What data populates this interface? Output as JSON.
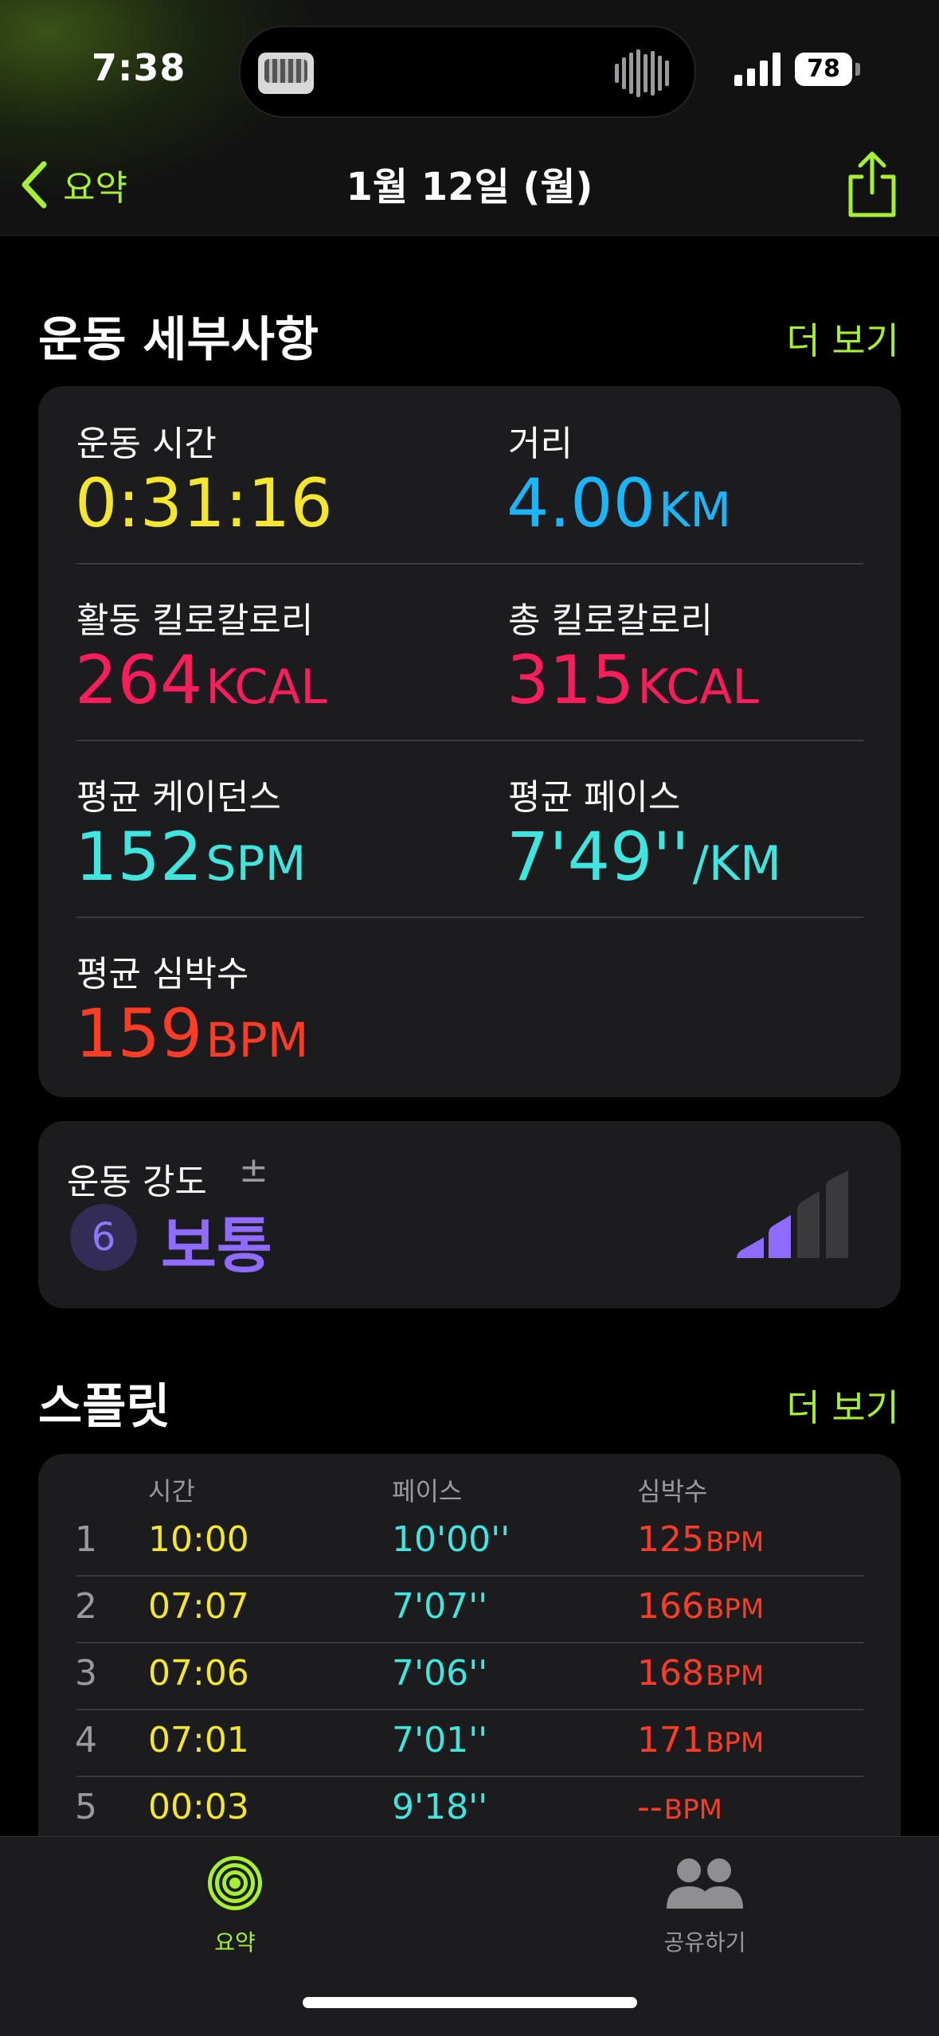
{
  "status_bar": {
    "time": "7:38",
    "battery": "78"
  },
  "nav": {
    "back_label": "요약",
    "title": "1월 12일 (월)"
  },
  "details": {
    "title": "운동 세부사항",
    "more": "더 보기",
    "metrics": [
      {
        "label": "운동 시간",
        "value": "0:31:16",
        "unit": "",
        "color": "#f4e62f"
      },
      {
        "label": "거리",
        "value": "4.00",
        "unit": "KM",
        "color": "#1bb6f9"
      },
      {
        "label": "활동 킬로칼로리",
        "value": "264",
        "unit": "KCAL",
        "color": "#fa1d5c"
      },
      {
        "label": "총 킬로칼로리",
        "value": "315",
        "unit": "KCAL",
        "color": "#fa1d5c"
      },
      {
        "label": "평균 케이던스",
        "value": "152",
        "unit": "SPM",
        "color": "#3fe6e0"
      },
      {
        "label": "평균 페이스",
        "value": "7'49''",
        "unit": "/KM",
        "color": "#3fe6e0"
      },
      {
        "label": "평균 심박수",
        "value": "159",
        "unit": "BPM",
        "color": "#fc3c24"
      }
    ]
  },
  "effort": {
    "label": "운동 강도",
    "pm": "±",
    "score": "6",
    "level": "보통",
    "bars_filled": 2,
    "bars_total": 4
  },
  "splits": {
    "title": "스플릿",
    "more": "더 보기",
    "headers": {
      "time": "시간",
      "pace": "페이스",
      "hr": "심박수"
    },
    "rows": [
      {
        "n": "1",
        "time": "10:00",
        "pace": "10'00''",
        "hr": "125",
        "unit": "BPM"
      },
      {
        "n": "2",
        "time": "07:07",
        "pace": "7'07''",
        "hr": "166",
        "unit": "BPM"
      },
      {
        "n": "3",
        "time": "07:06",
        "pace": "7'06''",
        "hr": "168",
        "unit": "BPM"
      },
      {
        "n": "4",
        "time": "07:01",
        "pace": "7'01''",
        "hr": "171",
        "unit": "BPM"
      },
      {
        "n": "5",
        "time": "00:03",
        "pace": "9'18''",
        "hr": "--",
        "unit": "BPM"
      }
    ]
  },
  "tabs": {
    "summary": "요약",
    "sharing": "공유하기"
  },
  "colors": {
    "accent": "#a5f032",
    "effort": "#8f6cff"
  }
}
